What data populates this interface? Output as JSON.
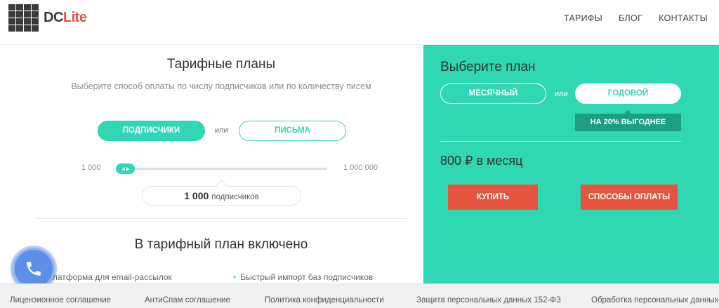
{
  "header": {
    "logo_main": "DC",
    "logo_accent": "Lite",
    "nav": [
      "ТАРИФЫ",
      "БЛОГ",
      "КОНТАКТЫ"
    ]
  },
  "left": {
    "title": "Тарифные планы",
    "subtitle": "Выберите способ оплаты по числу подписчиков или по количеству писем",
    "toggle": {
      "option_a": "ПОДПИСЧИКИ",
      "or": "или",
      "option_b": "ПИСЬМА",
      "selected": "ПОДПИСЧИКИ"
    },
    "slider": {
      "min_label": "1 000",
      "max_label": "1 000 000",
      "value_fraction": 0.0
    },
    "count": {
      "value": "1 000",
      "unit": "подписчиков"
    },
    "included_title": "В тарифный план включено",
    "features": [
      "Платформа для email-рассылок",
      "Быстрый импорт баз подписчиков"
    ]
  },
  "right": {
    "title": "Выберите план",
    "toggle": {
      "option_a": "МЕСЯЧНЫЙ",
      "or": "или",
      "option_b": "ГОДОВОЙ",
      "selected": "ГОДОВОЙ"
    },
    "promo": "НА 20% ВЫГОДНЕЕ",
    "price": "800 ₽ в месяц",
    "buy_button": "КУПИТЬ",
    "payment_button": "СПОСОБЫ ОПЛАТЫ"
  },
  "footer": {
    "links": [
      "Лицензионное соглашение",
      "АнтиСпам соглашение",
      "Политика конфиденциальности",
      "Защита персональных данных 152-ФЗ",
      "Обработка персональных данных"
    ]
  },
  "colors": {
    "accent": "#2fd8b2",
    "accent_dark": "#1c9e82",
    "button": "#e5543e",
    "phone": "#5b8fe8"
  },
  "icons": {
    "phone": "phone-icon"
  }
}
